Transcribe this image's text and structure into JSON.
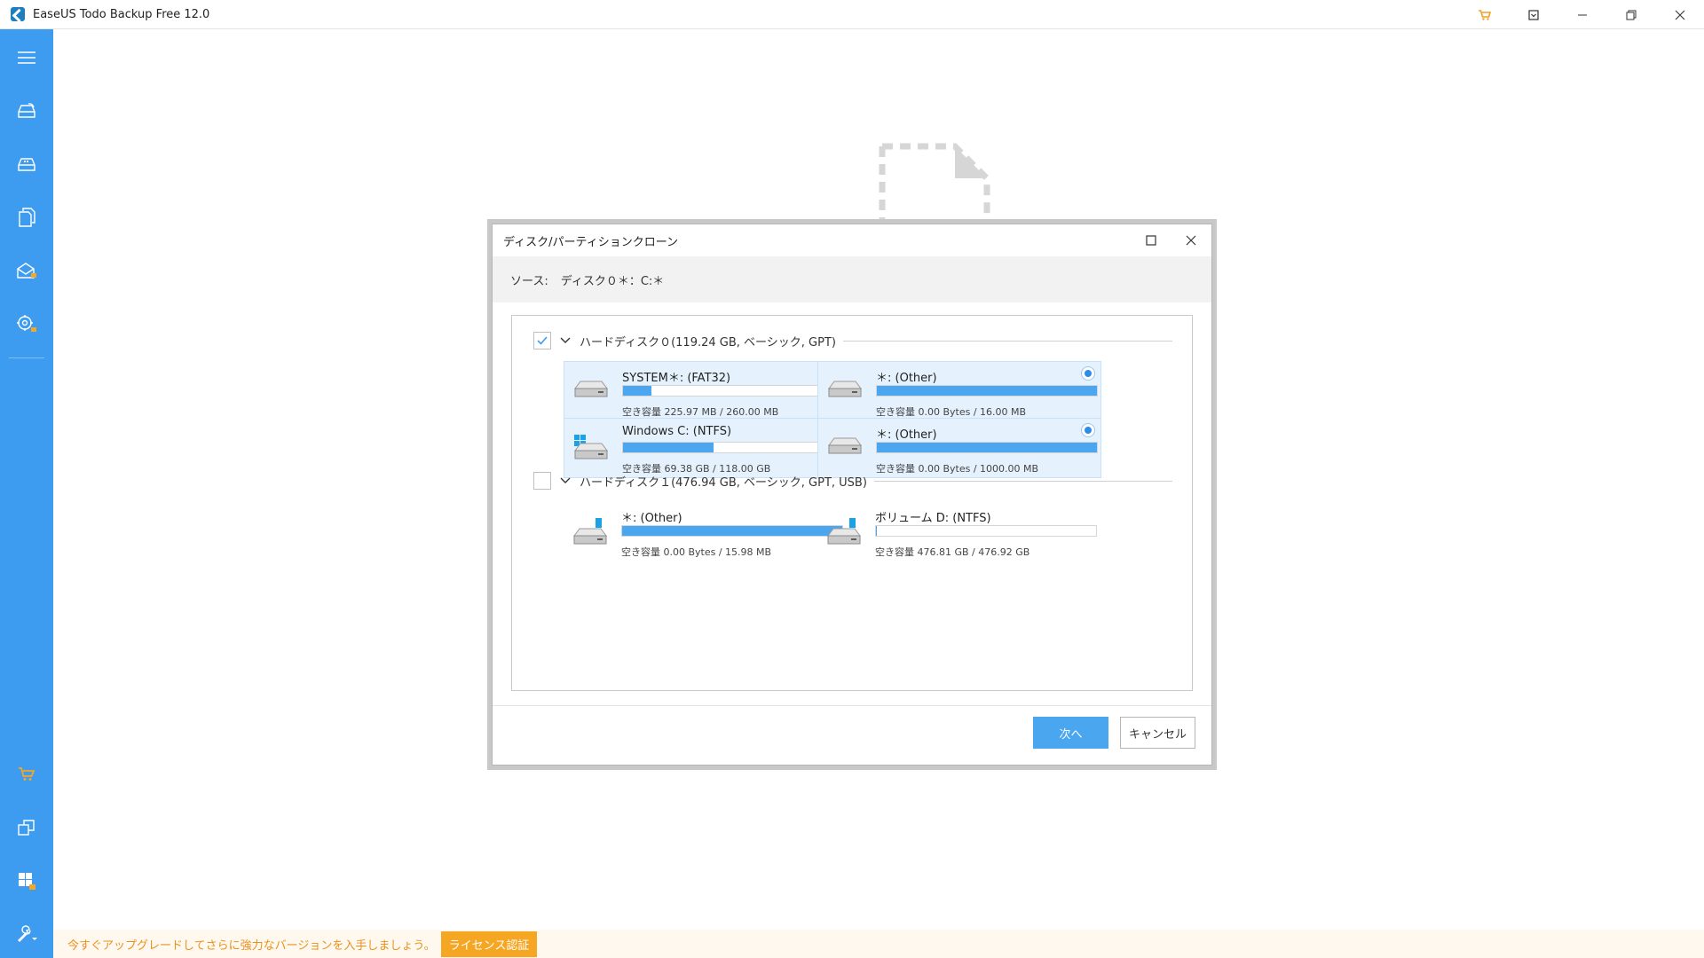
{
  "app": {
    "title": "EaseUS Todo Backup Free 12.0"
  },
  "titlebar_icons": [
    "cart-icon",
    "restore-down-icon",
    "minimize-icon",
    "maximize-icon",
    "close-icon"
  ],
  "sidebar": {
    "icons": [
      "menu-icon",
      "disk-backup-icon",
      "system-backup-icon",
      "file-backup-icon",
      "mail-backup-icon",
      "smart-backup-icon",
      "cart-icon",
      "clone-icon",
      "tools-windows-icon",
      "tools-wrench-icon"
    ]
  },
  "bottom_bar": {
    "upgrade_text": "今すぐアップグレードしてさらに強力なバージョンを入手しましょう。",
    "license_label": "ライセンス認証"
  },
  "dialog": {
    "title": "ディスク/パーティションクローン",
    "source_label": "ソース:",
    "source_value": "ディスク０＊：C:＊",
    "disks": [
      {
        "label": "ハードディスク０(119.24 GB, ベーシック, GPT)",
        "checked": true,
        "partitions": [
          {
            "name": "SYSTEM＊: (FAT32)",
            "free": "空き容量 225.97 MB / 260.00 MB",
            "used_fraction": 0.13,
            "icon": "hdd-icon",
            "selected": true
          },
          {
            "name": "＊: (Other)",
            "free": "空き容量 0.00 Bytes / 16.00 MB",
            "used_fraction": 1.0,
            "icon": "hdd-icon",
            "selected": true
          },
          {
            "name": "Windows C: (NTFS)",
            "free": "空き容量 69.38 GB / 118.00 GB",
            "used_fraction": 0.41,
            "icon": "windows-hdd-icon",
            "selected": true
          },
          {
            "name": "＊: (Other)",
            "free": "空き容量 0.00 Bytes / 1000.00 MB",
            "used_fraction": 1.0,
            "icon": "hdd-icon",
            "selected": true
          }
        ]
      },
      {
        "label": "ハードディスク１(476.94 GB, ベーシック, GPT, USB)",
        "checked": false,
        "partitions": [
          {
            "name": "＊: (Other)",
            "free": "空き容量 0.00 Bytes / 15.98 MB",
            "used_fraction": 1.0,
            "icon": "usb-drive-icon",
            "selected": false
          },
          {
            "name": "ボリューム D: (NTFS)",
            "free": "空き容量 476.81 GB / 476.92 GB",
            "used_fraction": 0.003,
            "icon": "usb-drive-icon",
            "selected": false
          }
        ]
      }
    ],
    "next_label": "次へ",
    "cancel_label": "キャンセル"
  },
  "colors": {
    "sidebar": "#3d9cf0",
    "accent": "#4aa6ef",
    "selected_bg": "#e5f2fd",
    "license": "#f5a623"
  }
}
